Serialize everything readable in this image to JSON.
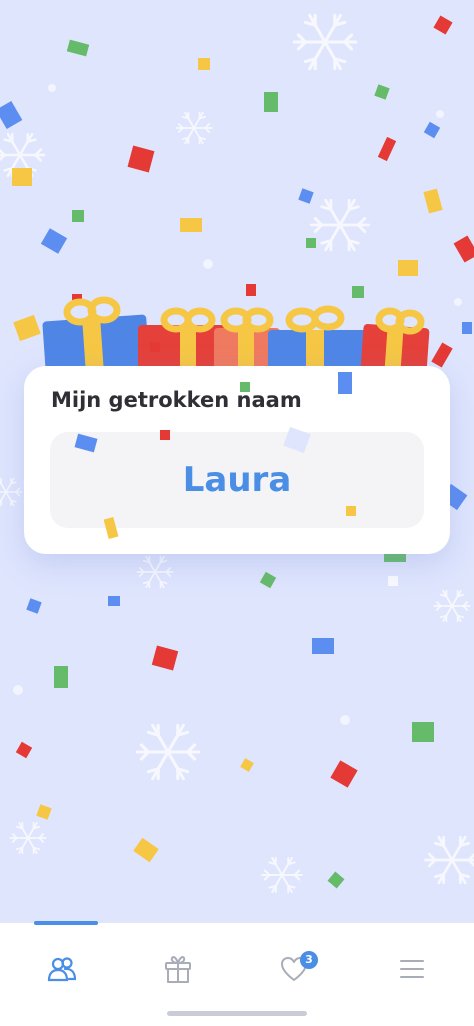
{
  "card": {
    "title": "Mijn getrokken naam",
    "drawn_name": "Laura"
  },
  "tabbar": {
    "active_tab": "group",
    "tabs": [
      {
        "name": "group",
        "icon": "people-icon"
      },
      {
        "name": "gifts",
        "icon": "gift-icon"
      },
      {
        "name": "wishlist",
        "icon": "heart-icon",
        "badge": "3"
      },
      {
        "name": "menu",
        "icon": "hamburger-menu-icon"
      }
    ]
  },
  "colors": {
    "background": "#dfe5fd",
    "accent": "#4a8ee6",
    "confetti": [
      "#e53935",
      "#66bb6a",
      "#5c8df0",
      "#f6c744"
    ]
  }
}
